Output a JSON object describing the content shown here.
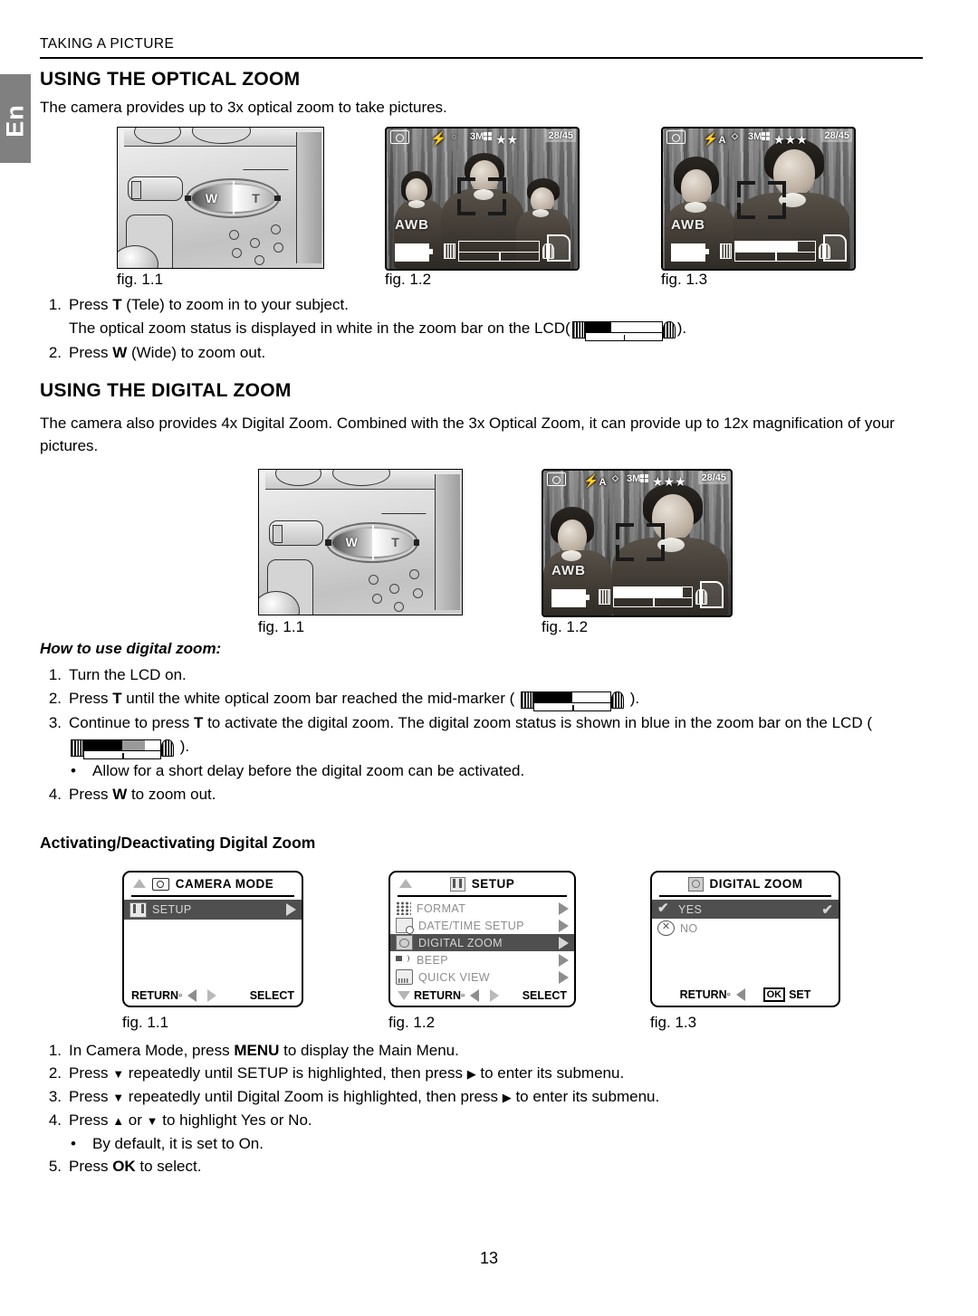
{
  "page": {
    "running_head": "TAKING A PICTURE",
    "side_tab": "En",
    "page_number": "13"
  },
  "section_optical": {
    "heading": "USING THE OPTICAL ZOOM",
    "intro": "The camera provides up to 3x optical zoom to take pictures.",
    "figures": [
      {
        "caption": "fig. 1.1",
        "kind": "camera-illustration"
      },
      {
        "caption": "fig. 1.2",
        "kind": "lcd-screen"
      },
      {
        "caption": "fig. 1.3",
        "kind": "lcd-screen"
      }
    ],
    "steps": [
      {
        "num": "1.",
        "text_a": "Press ",
        "bold": "T",
        "text_b": " (Tele) to zoom in to your subject."
      },
      {
        "num": "2.",
        "text_a": "Press ",
        "bold": "W",
        "text_b": " (Wide) to zoom out."
      }
    ],
    "step1_note_a": "The optical zoom status is displayed in white in the zoom bar on the LCD(",
    "step1_note_b": ")."
  },
  "section_digital": {
    "heading": "USING THE DIGITAL ZOOM",
    "intro": "The camera also provides 4x Digital Zoom. Combined with the 3x Optical Zoom, it can provide up to 12x magnification of your pictures.",
    "figures": [
      {
        "caption": "fig. 1.1",
        "kind": "camera-illustration"
      },
      {
        "caption": "fig. 1.2",
        "kind": "lcd-screen"
      }
    ],
    "howto_heading": "How to use digital zoom:",
    "steps": [
      {
        "num": "1.",
        "text": "Turn the LCD on."
      },
      {
        "num": "2.",
        "a": "Press ",
        "b": "T",
        "c": " until the white optical zoom bar reached the mid-marker ( ",
        "d": " )."
      },
      {
        "num": "3.",
        "a": "Continue to press ",
        "b": "T",
        "c": " to activate the digital zoom. The digital zoom status is shown in blue in the zoom bar on the LCD ( ",
        "d": " )."
      },
      {
        "num": "4.",
        "a": "Press ",
        "b": "W",
        "c": " to zoom out."
      }
    ],
    "bullet": "Allow for a short delay before the digital zoom can be activated."
  },
  "section_activate": {
    "heading": "Activating/Deactivating Digital Zoom",
    "figures": [
      {
        "caption": "fig. 1.1"
      },
      {
        "caption": "fig. 1.2"
      },
      {
        "caption": "fig. 1.3"
      }
    ],
    "steps": [
      {
        "num": "1.",
        "a": "In Camera Mode, press ",
        "b": "MENU",
        "c": " to display the Main Menu."
      },
      {
        "num": "2.",
        "a": "Press ",
        "c": " repeatedly until SETUP is highlighted, then press ",
        "e": " to enter its submenu."
      },
      {
        "num": "3.",
        "a": "Press ",
        "c": " repeatedly until Digital Zoom is highlighted, then press ",
        "e": " to enter its submenu."
      },
      {
        "num": "4.",
        "a": "Press ",
        "c": " or ",
        "e": " to highlight Yes or No."
      },
      {
        "num": "5.",
        "a": "Press ",
        "b": "OK",
        "c": " to select."
      }
    ],
    "bullet": "By default, it is set to On."
  },
  "menus": {
    "camera_mode": {
      "title": "CAMERA MODE",
      "title_icon": "camera-icon",
      "rows": [
        {
          "label": "SETUP",
          "icon": "setup-icon",
          "highlighted": true,
          "arrow": true
        }
      ],
      "footer_left": "RETURN",
      "footer_right": "SELECT"
    },
    "setup": {
      "title": "SETUP",
      "title_icon": "setup-icon",
      "rows": [
        {
          "label": "FORMAT",
          "icon": "format-icon",
          "highlighted": false,
          "arrow": true
        },
        {
          "label": "DATE/TIME SETUP",
          "icon": "date-time-icon",
          "highlighted": false,
          "arrow": true
        },
        {
          "label": "DIGITAL ZOOM",
          "icon": "digital-zoom-icon",
          "highlighted": true,
          "arrow": true
        },
        {
          "label": "BEEP",
          "icon": "beep-icon",
          "highlighted": false,
          "arrow": true
        },
        {
          "label": "QUICK VIEW",
          "icon": "quick-view-icon",
          "highlighted": false,
          "arrow": true
        }
      ],
      "footer_left": "RETURN",
      "footer_right": "SELECT"
    },
    "digital_zoom": {
      "title": "DIGITAL  ZOOM",
      "title_icon": "digital-zoom-icon",
      "rows": [
        {
          "label": "YES",
          "icon": "check-icon",
          "highlighted": true,
          "checked": true
        },
        {
          "label": "NO",
          "icon": "x-circle-icon",
          "highlighted": false,
          "checked": false
        }
      ],
      "footer_left": "RETURN",
      "footer_ok": "OK",
      "footer_right": "SET"
    }
  },
  "lcd": {
    "fig12_optical": {
      "mode_icon": "camera-icon",
      "flash_icon": "flash-icon",
      "resolution": "3M",
      "quality_stars": "★★",
      "frame_count": "28/45",
      "white_balance": "AWB",
      "battery_icon": "battery-icon",
      "card_icon": "memory-card-icon",
      "zoom_fill_percent": 0
    },
    "fig13_optical": {
      "mode_icon": "camera-icon",
      "flash_icon": "flash-auto-icon",
      "flash_label": "A",
      "resolution": "3M",
      "quality_stars": "★★★",
      "frame_count": "28/45",
      "white_balance": "AWB",
      "battery_icon": "battery-icon",
      "card_icon": "memory-card-icon",
      "zoom_fill_percent": 78
    },
    "fig12_digital": {
      "mode_icon": "camera-icon",
      "flash_icon": "flash-auto-icon",
      "flash_label": "A",
      "resolution": "3M",
      "quality_stars": "★★★",
      "frame_count": "28/45",
      "white_balance": "AWB",
      "battery_icon": "battery-icon",
      "card_icon": "memory-card-icon",
      "zoom_fill_percent": 88
    }
  },
  "zoom_glyphs": {
    "optical_white": {
      "fill_percent": 34,
      "fill_color": "#000000"
    },
    "optical_mid": {
      "fill_percent": 50,
      "fill_color": "#000000"
    },
    "digital_blue": {
      "fill_percent": 50,
      "fill_color": "#000000",
      "second_percent": 30,
      "second_color": "#9a9a9a"
    }
  }
}
